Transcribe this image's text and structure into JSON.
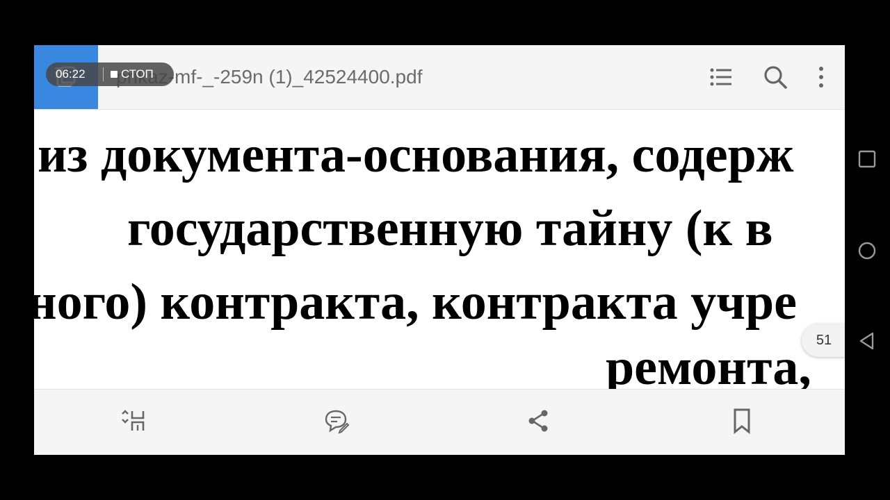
{
  "screen_recorder": {
    "time": "06:22",
    "stop_label": "СТОП"
  },
  "app_bar": {
    "file_name": "prikaz-mf-_-259n (1)_42524400.pdf",
    "icons": [
      "home-icon",
      "menu-icon",
      "outline-list-icon",
      "search-icon",
      "more-vertical-icon"
    ],
    "accent_color": "#3a87e0"
  },
  "document": {
    "lines": [
      "из документа-основания, содерж",
      "государственную тайну (к в",
      "ного) контракта, контракта учре",
      "ремонта,"
    ]
  },
  "page_indicator": {
    "page": "51"
  },
  "bottom_toolbar": {
    "icons": [
      "reflow-icon",
      "comment-icon",
      "share-icon",
      "bookmark-icon"
    ]
  },
  "system_nav": {
    "icons": [
      "recents-square-icon",
      "home-circle-icon",
      "back-triangle-icon"
    ]
  }
}
